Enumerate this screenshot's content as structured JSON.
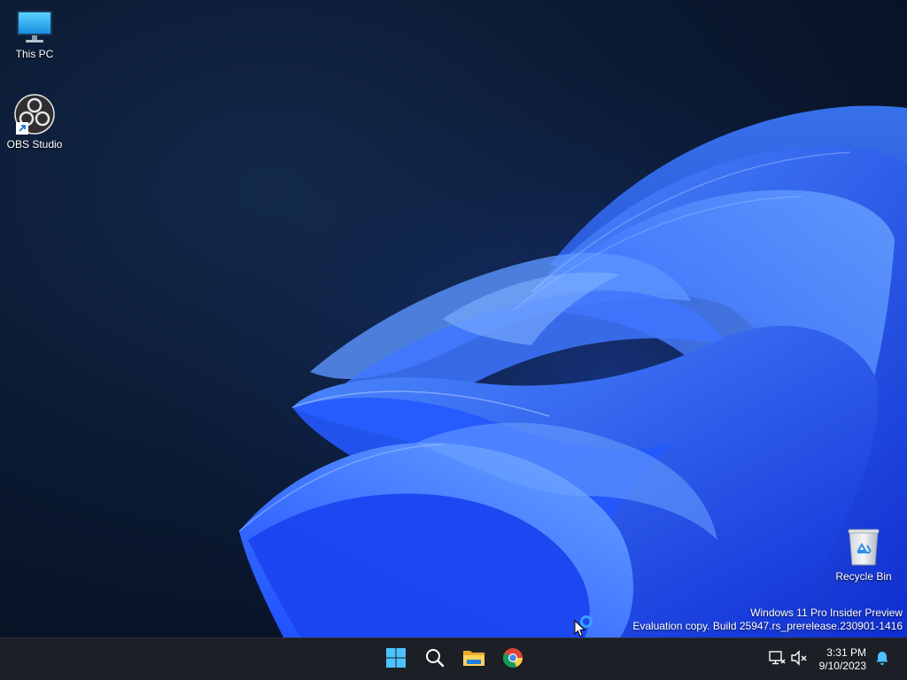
{
  "desktop": {
    "icons": [
      {
        "label": "This PC",
        "icon": "monitor-icon"
      },
      {
        "label": "OBS Studio",
        "icon": "obs-icon"
      },
      {
        "label": "Recycle Bin",
        "icon": "recycle-bin-icon"
      }
    ],
    "watermark": {
      "line1": "Windows 11 Pro Insider Preview",
      "line2": "Evaluation copy. Build 25947.rs_prerelease.230901-1416"
    }
  },
  "taskbar": {
    "apps": [
      {
        "name": "Start",
        "icon": "windows-start-icon"
      },
      {
        "name": "Search",
        "icon": "search-icon"
      },
      {
        "name": "File Explorer",
        "icon": "folder-icon"
      },
      {
        "name": "Google Chrome",
        "icon": "chrome-icon"
      }
    ],
    "tray": {
      "network_icon": "network-disconnected-icon",
      "volume_icon": "volume-muted-icon",
      "time": "3:31 PM",
      "date": "9/10/2023",
      "notification_icon": "bell-icon"
    }
  },
  "colors": {
    "accent": "#2b6cff",
    "taskbar": "#1c1f26",
    "desktop_dark": "#0b1a33"
  }
}
